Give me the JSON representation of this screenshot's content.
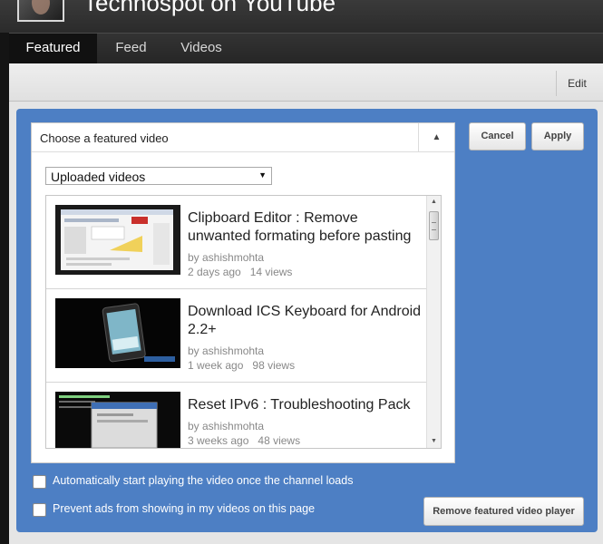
{
  "header": {
    "channel_title": "Technospot on YouTube"
  },
  "tabs": [
    {
      "label": "Featured",
      "active": true
    },
    {
      "label": "Feed",
      "active": false
    },
    {
      "label": "Videos",
      "active": false
    }
  ],
  "subbar": {
    "edit_label": "Edit"
  },
  "chooser": {
    "title": "Choose a featured video",
    "toggle_icon": "chevron-up-icon",
    "source_select": {
      "value": "Uploaded videos"
    },
    "videos": [
      {
        "title": "Clipboard Editor : Remove unwanted formating before pasting",
        "author": "by ashishmohta",
        "age": "2 days ago",
        "views": "14 views"
      },
      {
        "title": "Download ICS Keyboard for Android 2.2+",
        "author": "by ashishmohta",
        "age": "1 week ago",
        "views": "98 views"
      },
      {
        "title": "Reset IPv6 : Troubleshooting Pack",
        "author": "by ashishmohta",
        "age": "3 weeks ago",
        "views": "48 views"
      }
    ]
  },
  "actions": {
    "cancel_label": "Cancel",
    "apply_label": "Apply",
    "remove_label": "Remove featured video player"
  },
  "options": {
    "autoplay_label": "Automatically start playing the video once the channel loads",
    "autoplay_checked": false,
    "prevent_ads_label": "Prevent ads from showing in my videos on this page",
    "prevent_ads_checked": false
  },
  "colors": {
    "panel_blue": "#4d7fc4",
    "topbar": "#2b2b2b"
  }
}
